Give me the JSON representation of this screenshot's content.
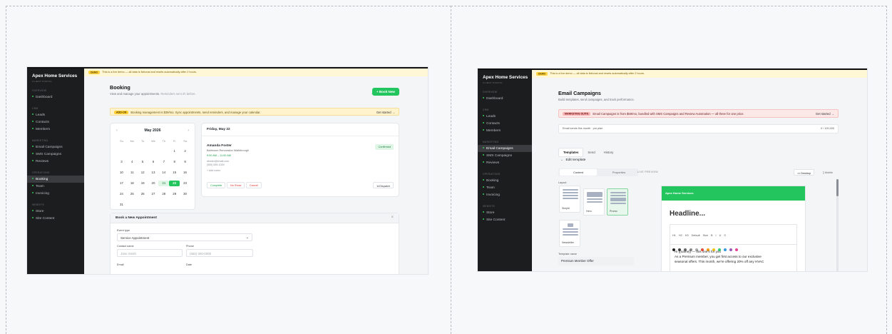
{
  "booking": {
    "sidebar": {
      "brand": "Apex Home Services",
      "portal": "CLIENT PORTAL",
      "sections": [
        {
          "title": "OVERVIEW",
          "items": [
            "Dashboard"
          ]
        },
        {
          "title": "CRM",
          "items": [
            "Leads",
            "Contacts",
            "Members"
          ]
        },
        {
          "title": "MARKETING",
          "items": [
            "Email Campaigns",
            "SMS Campaigns",
            "Reviews"
          ]
        },
        {
          "title": "OPERATIONS",
          "items": [
            "Booking",
            "Team",
            "Invoicing"
          ]
        },
        {
          "title": "WEBSITE",
          "items": [
            "Store",
            "Site Content"
          ]
        }
      ],
      "active": "Booking"
    },
    "demo_tag": "DEMO",
    "demo_text": "This is a live demo — all data is fictional and resets automatically after 2 hours.",
    "title": "Booking",
    "subtitle": "View and manage your appointments.",
    "subtitle_muted": "Reminders sent 2h before.",
    "export_label": "Export",
    "book_label": "+ Book New",
    "addon_tag": "ADD-ON",
    "addon_text": "Booking management is $39/mo. Sync appointments, send reminders, and manage your calendar.",
    "addon_cta": "Get started →",
    "calendar": {
      "month": "May 2026",
      "weekdays": [
        "Su",
        "Mo",
        "Tu",
        "We",
        "Th",
        "Fr",
        "Sa"
      ],
      "days": [
        "",
        "",
        "",
        "",
        "",
        "1",
        "2",
        "3",
        "4",
        "5",
        "6",
        "7",
        "8",
        "9",
        "10",
        "11",
        "12",
        "13",
        "14",
        "15",
        "16",
        "17",
        "18",
        "19",
        "20",
        "21",
        "22",
        "23",
        "24",
        "25",
        "26",
        "27",
        "28",
        "29",
        "30",
        "31"
      ],
      "selected": "22",
      "tinted": "21"
    },
    "day_title": "Friday, May 22",
    "appointment": {
      "name": "Amanda Foster",
      "service": "Bathroom Renovation Walkthrough",
      "time": "9:00 AM – 11:00 AM",
      "email": "afoster@email.com",
      "phone": "(555) 555-1000",
      "notes": "+ Add notes",
      "status": "Confirmed",
      "actions": [
        "Complete",
        "No Show",
        "Cancel"
      ],
      "dispatch": "Dispatch"
    },
    "form": {
      "title": "Book a New Appointment",
      "close": "×",
      "event_type_label": "Event type",
      "event_type_value": "Service Appointment",
      "contact_label": "Contact name",
      "contact_placeholder": "Jane Smith",
      "phone_label": "Phone",
      "phone_placeholder": "(555) 000-0000",
      "email_label": "Email",
      "date_label": "Date"
    }
  },
  "email": {
    "sidebar": {
      "brand": "Apex Home Services",
      "portal": "CLIENT PORTAL",
      "sections": [
        {
          "title": "OVERVIEW",
          "items": [
            "Dashboard"
          ]
        },
        {
          "title": "CRM",
          "items": [
            "Leads",
            "Contacts",
            "Members"
          ]
        },
        {
          "title": "MARKETING",
          "items": [
            "Email Campaigns",
            "SMS Campaigns",
            "Reviews"
          ]
        },
        {
          "title": "OPERATIONS",
          "items": [
            "Booking",
            "Team",
            "Invoicing"
          ]
        },
        {
          "title": "WEBSITE",
          "items": [
            "Store",
            "Site Content"
          ]
        }
      ],
      "active": "Email Campaigns"
    },
    "demo_tag": "DEMO",
    "demo_text": "This is a live demo — all data is fictional and resets automatically after 2 hours.",
    "title": "Email Campaigns",
    "subtitle": "Build templates, send campaigns, and track performance.",
    "addon_tag": "MARKETING SUITE",
    "addon_text": "Email Campaigns is from $59/mo, bundled with SMS Campaigns and Review Automation — all three for one price.",
    "addon_cta": "Get started →",
    "usage_label": "Email sends this month · pro plan",
    "usage_value": "0 / 100,000",
    "tabs": [
      "Templates",
      "Send",
      "History"
    ],
    "active_tab": "Templates",
    "edit_label": "Edit template",
    "editor_tabs": [
      "Content",
      "Properties"
    ],
    "live_preview": "LIVE PREVIEW",
    "desktop": "Desktop",
    "mobile": "Mobile",
    "layout_label": "Layout",
    "layouts": [
      "Simple",
      "Hero",
      "Promo",
      "Newsletter"
    ],
    "selected_layout": "Promo",
    "template_name_label": "Template name",
    "template_name": "Premium Member Offer",
    "preview_header": "Apex Home Services",
    "headline": "Headline...",
    "toolbar": [
      "H1",
      "H2",
      "H3",
      "Default",
      "Size",
      "B",
      "I",
      "U",
      "S"
    ],
    "body_lines": [
      "Hi {{name}} — this one's for you",
      "As a Premium member, you get first access to our exclusive",
      "seasonal offers. This month, we're offering 20% off any HVAC"
    ],
    "swatch_colors": [
      "#222222",
      "#444444",
      "#666666",
      "#888888",
      "#aaaaaa",
      "#e74c3c",
      "#f39c12",
      "#f1c40f",
      "#2ecc71",
      "#3498db",
      "#9b59b6",
      "#e84393"
    ]
  }
}
